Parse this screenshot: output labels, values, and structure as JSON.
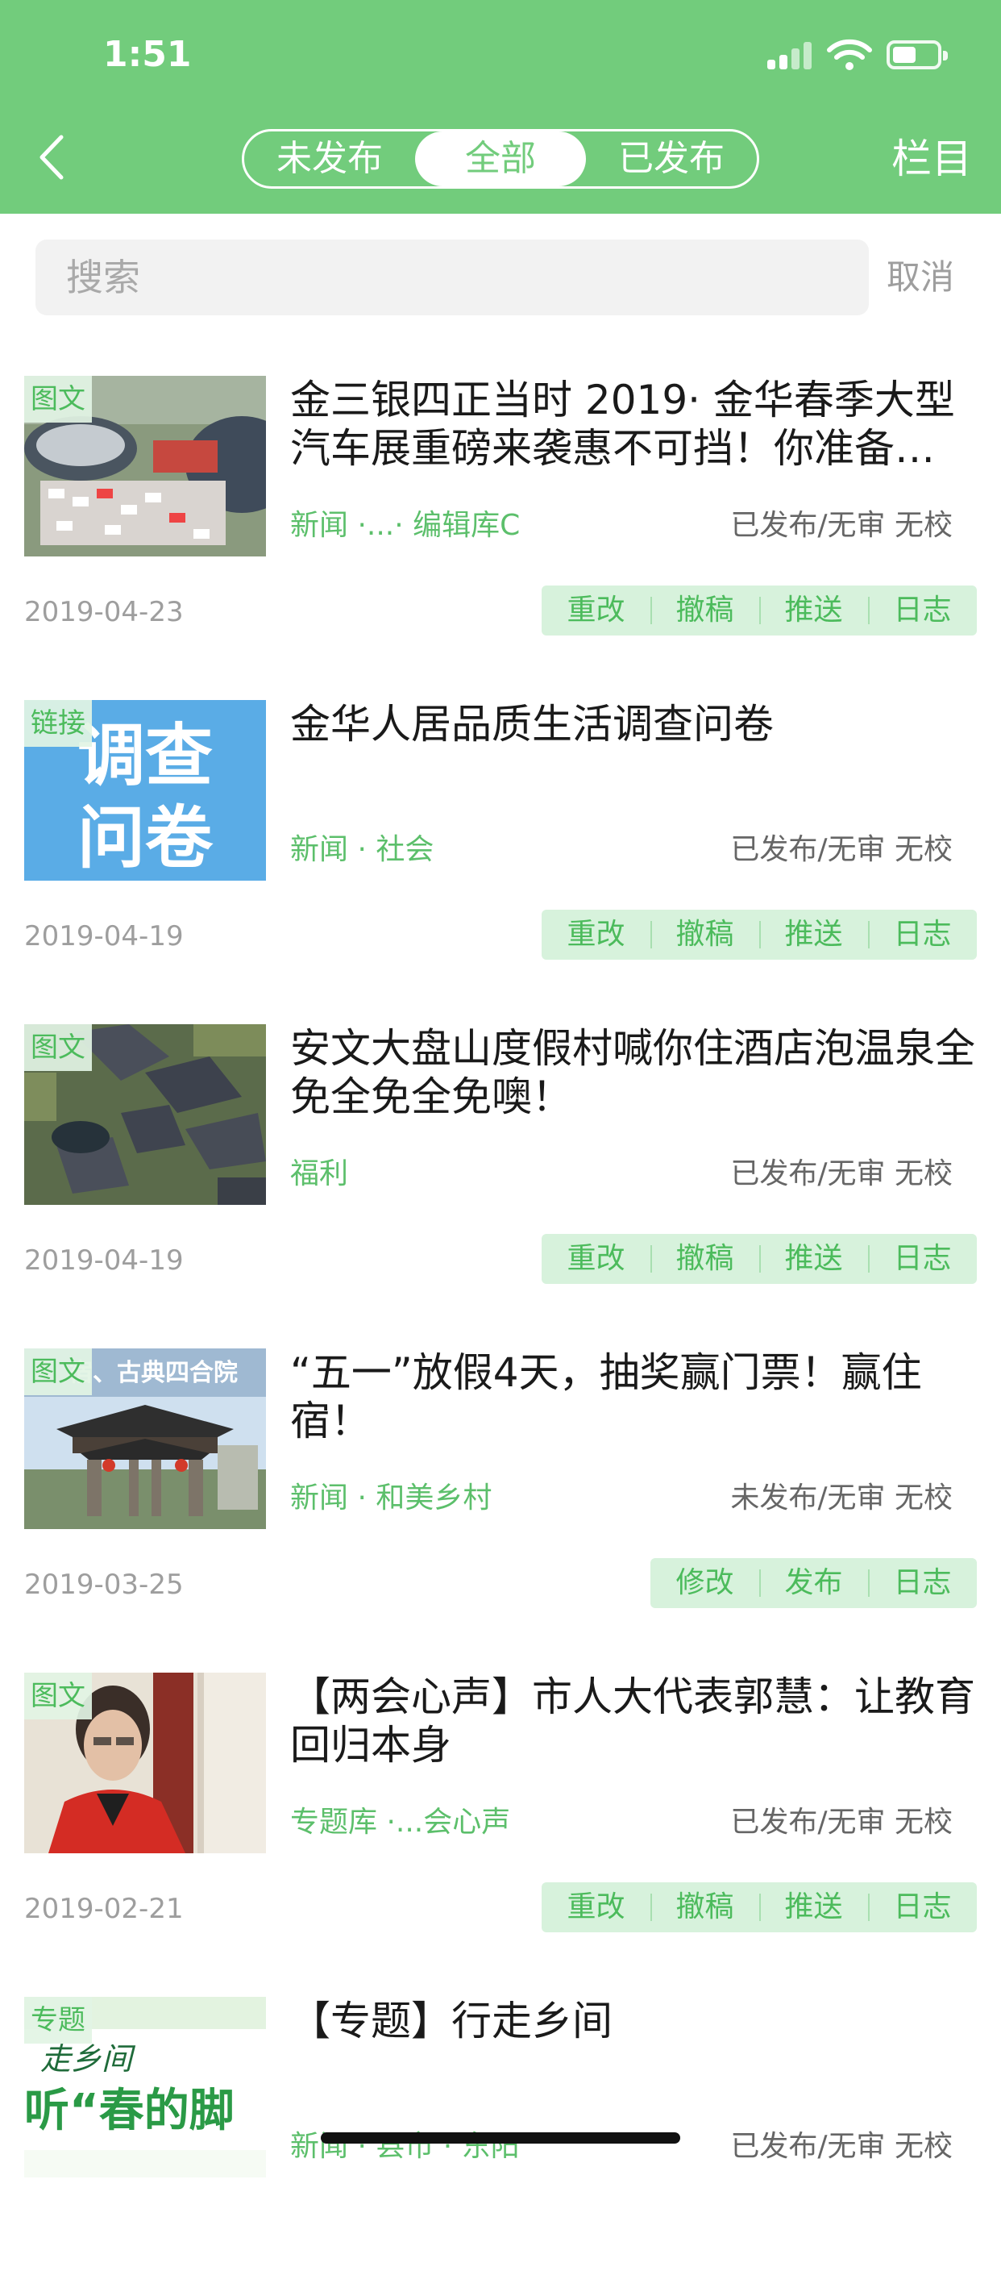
{
  "status_bar": {
    "time": "1:51"
  },
  "nav": {
    "segments": [
      "未发布",
      "全部",
      "已发布"
    ],
    "active_segment": "全部",
    "column_label": "栏目"
  },
  "search": {
    "placeholder": "搜索",
    "value": "",
    "cancel_label": "取消"
  },
  "colors": {
    "header": "#72cc7c",
    "accent": "#4cbb5c",
    "action_bg": "#d7f2dc"
  },
  "articles": [
    {
      "type": "图文",
      "title": "金三银四正当时 2019· 金华春季大型汽车展重磅来袭惠不可挡！你准备…",
      "category": "新闻 ·...· 编辑库C",
      "status": "已发布/无审 无校",
      "date": "2019-04-23",
      "actions": [
        "重改",
        "撤稿",
        "推送",
        "日志"
      ]
    },
    {
      "type": "链接",
      "title": "金华人居品质生活调查问卷",
      "category": "新闻 · 社会",
      "status": "已发布/无审 无校",
      "date": "2019-04-19",
      "thumb_text": [
        "调查",
        "问卷"
      ],
      "actions": [
        "重改",
        "撤稿",
        "推送",
        "日志"
      ]
    },
    {
      "type": "图文",
      "title": "安文大盘山度假村喊你住酒店泡温泉全免全免全免噢！",
      "category": "福利",
      "status": "已发布/无审 无校",
      "date": "2019-04-19",
      "actions": [
        "重改",
        "撤稿",
        "推送",
        "日志"
      ]
    },
    {
      "type": "图文",
      "title": "“五一”放假4天，抽奖赢门票！赢住宿！",
      "category": "新闻 · 和美乡村",
      "status": "未发布/无审 无校",
      "date": "2019-03-25",
      "thumb_text": [
        "宿、古典四合院"
      ],
      "actions": [
        "修改",
        "发布",
        "日志"
      ]
    },
    {
      "type": "图文",
      "title": "【两会心声】市人大代表郭慧：让教育回归本身",
      "category": "专题库 ·...会心声",
      "status": "已发布/无审 无校",
      "date": "2019-02-21",
      "actions": [
        "重改",
        "撤稿",
        "推送",
        "日志"
      ]
    },
    {
      "type": "专题",
      "title": "【专题】行走乡间",
      "category": "新闻 · 县市 · 东阳",
      "status": "已发布/无审 无校",
      "thumb_text": [
        "走乡间",
        "听“春的脚"
      ],
      "actions": []
    }
  ]
}
